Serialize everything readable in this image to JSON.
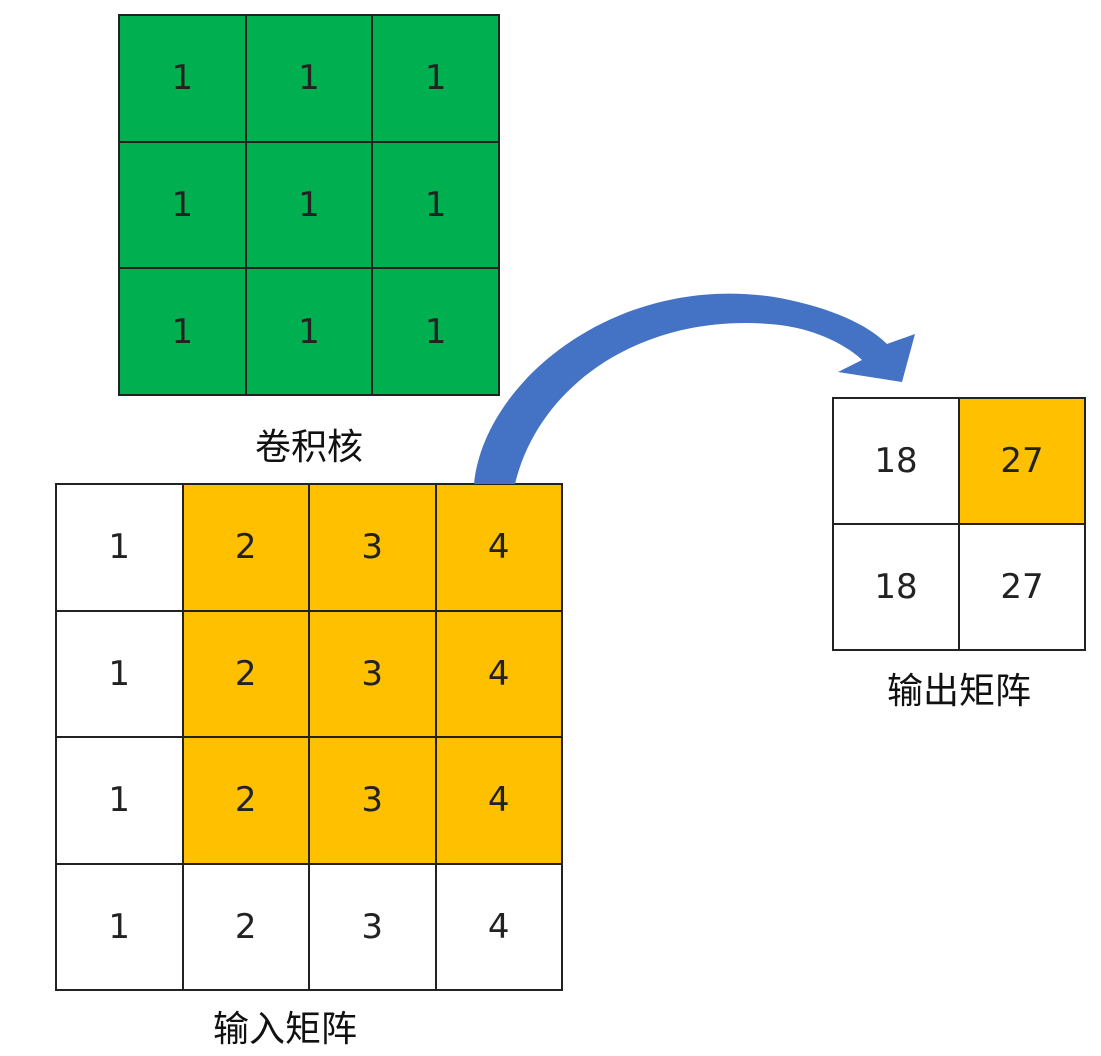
{
  "colors": {
    "kernel_fill": "#00b050",
    "highlight_fill": "#ffc000",
    "plain_fill": "#ffffff",
    "arrow_fill": "#4472c4",
    "grid_line": "#222222"
  },
  "kernel": {
    "label": "卷积核",
    "rows": [
      [
        "1",
        "1",
        "1"
      ],
      [
        "1",
        "1",
        "1"
      ],
      [
        "1",
        "1",
        "1"
      ]
    ]
  },
  "input_matrix": {
    "label": "输入矩阵",
    "rows": [
      [
        "1",
        "2",
        "3",
        "4"
      ],
      [
        "1",
        "2",
        "3",
        "4"
      ],
      [
        "1",
        "2",
        "3",
        "4"
      ],
      [
        "1",
        "2",
        "3",
        "4"
      ]
    ],
    "highlighted_region": "rows 1-3, columns 2-4"
  },
  "output_matrix": {
    "label": "输出矩阵",
    "rows": [
      [
        "18",
        "27"
      ],
      [
        "18",
        "27"
      ]
    ],
    "highlighted_cell": "row 1, column 2"
  }
}
